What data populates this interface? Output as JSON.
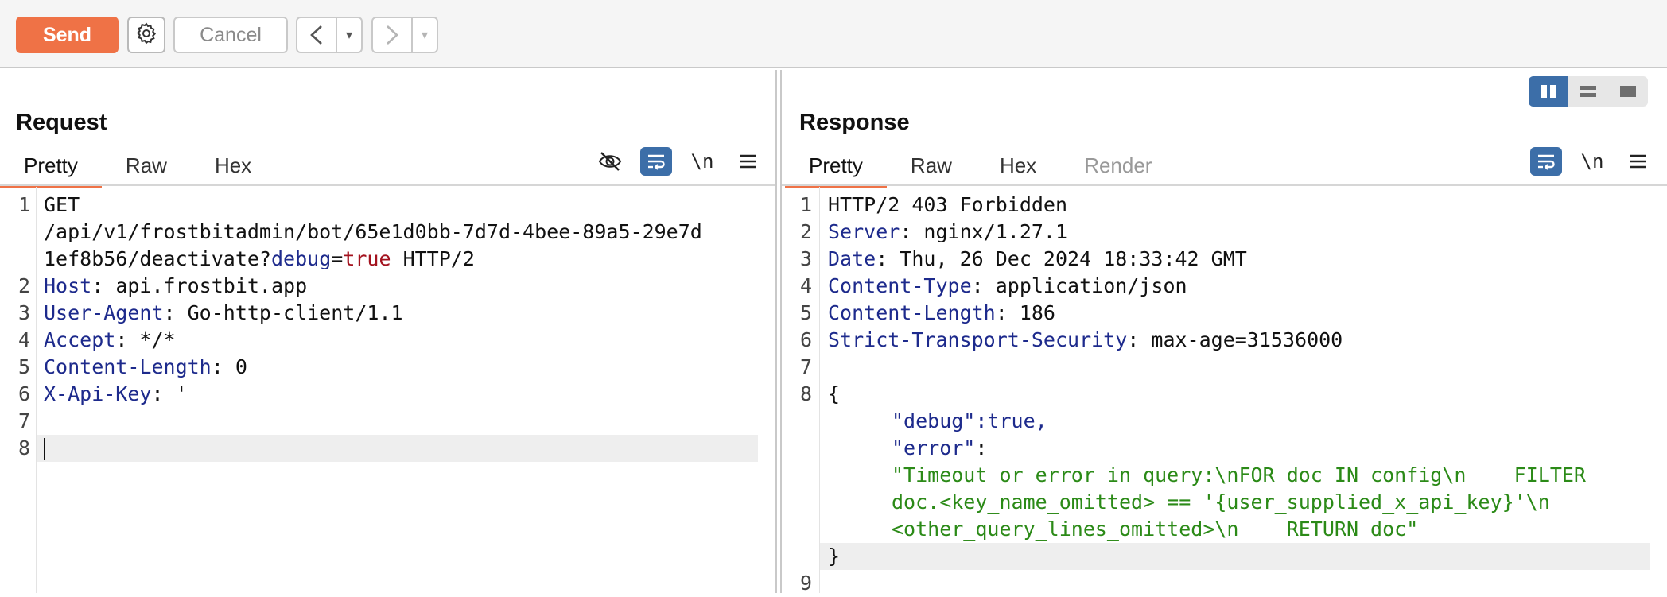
{
  "toolbar": {
    "send_label": "Send",
    "cancel_label": "Cancel",
    "back_symbol": "<",
    "forward_symbol": ">",
    "dropdown_symbol": "▾"
  },
  "request": {
    "title": "Request",
    "tabs": [
      "Pretty",
      "Raw",
      "Hex"
    ],
    "active_tab": "Pretty",
    "newline_toggle": "\\n",
    "lines": {
      "l1_method": "GET",
      "l1_path_a": "/api/v1/frostbitadmin/bot/65e1d0bb-7d7d-4bee-89a5-29e7d",
      "l1_path_b": "1ef8b56/deactivate?",
      "l1_param": "debug",
      "l1_eq": "=",
      "l1_param_val": "true",
      "l1_proto": " HTTP/2",
      "l2_key": "Host",
      "l2_val": ": api.frostbit.app",
      "l3_key": "User-Agent",
      "l3_val": ": Go-http-client/1.1",
      "l4_key": "Accept",
      "l4_val": ": */*",
      "l5_key": "Content-Length",
      "l5_val": ": 0",
      "l6_key": "X-Api-Key",
      "l6_val": ": '"
    }
  },
  "response": {
    "title": "Response",
    "tabs": [
      "Pretty",
      "Raw",
      "Hex",
      "Render"
    ],
    "active_tab": "Pretty",
    "newline_toggle": "\\n",
    "lines": {
      "l1": "HTTP/2 403 Forbidden",
      "l2_key": "Server",
      "l2_val": ": nginx/1.27.1",
      "l3_key": "Date",
      "l3_val": ": Thu, 26 Dec 2024 18:33:42 GMT",
      "l4_key": "Content-Type",
      "l4_val": ": application/json",
      "l5_key": "Content-Length",
      "l5_val": ": 186",
      "l6_key": "Strict-Transport-Security",
      "l6_val": ": max-age=31536000",
      "l8_open": "{",
      "debug_key": "\"debug\"",
      "debug_val": ":true,",
      "error_key": "\"error\"",
      "error_colon": ":",
      "error_a": "\"Timeout or error in query:\\nFOR doc IN config\\n    FILTER",
      "error_b": "doc.<key_name_omitted> == '{user_supplied_x_api_key}'\\n",
      "error_c": "<other_query_lines_omitted>\\n    RETURN doc\"",
      "close": "}"
    }
  },
  "line_numbers": [
    "1",
    "2",
    "3",
    "4",
    "5",
    "6",
    "7",
    "8",
    "9"
  ]
}
